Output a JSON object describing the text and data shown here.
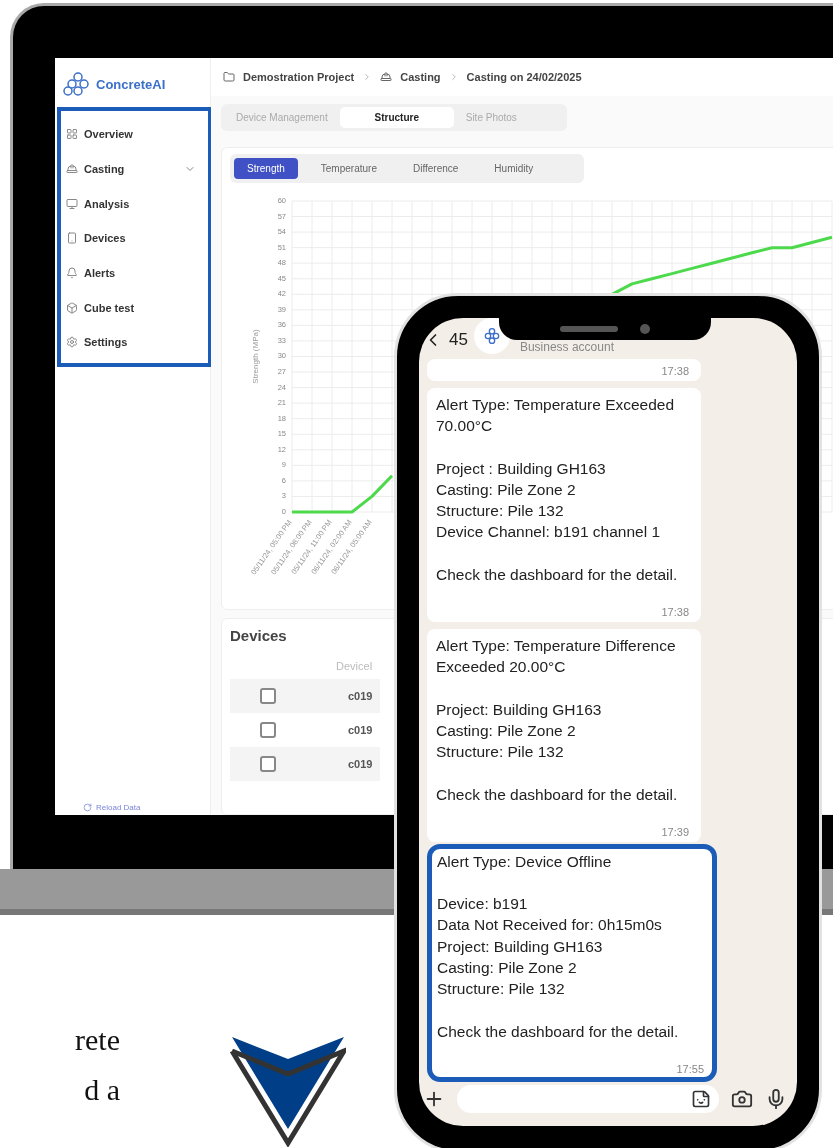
{
  "sidebar": {
    "logo": "ConcreteAI",
    "items": [
      {
        "label": "Overview",
        "expandable": false
      },
      {
        "label": "Casting",
        "expandable": true
      },
      {
        "label": "Analysis",
        "expandable": false
      },
      {
        "label": "Devices",
        "expandable": false
      },
      {
        "label": "Alerts",
        "expandable": false
      },
      {
        "label": "Cube test",
        "expandable": false
      },
      {
        "label": "Settings",
        "expandable": false
      }
    ],
    "reload": "Reload Data"
  },
  "breadcrumb": [
    "Demostration Project",
    "Casting",
    "Casting on 24/02/2025"
  ],
  "tabs": [
    {
      "label": "Device Management",
      "selected": false
    },
    {
      "label": "Structure",
      "selected": true
    },
    {
      "label": "Site Photos",
      "selected": false
    }
  ],
  "chart_tabs": [
    {
      "label": "Strength",
      "selected": true
    },
    {
      "label": "Temperature",
      "selected": false
    },
    {
      "label": "Difference",
      "selected": false
    },
    {
      "label": "Humidity",
      "selected": false
    }
  ],
  "chart_data": {
    "type": "line",
    "grid": true,
    "ylabel": "Strength (MPa)",
    "ylim": [
      0,
      60
    ],
    "yticks": [
      0,
      3,
      6,
      9,
      12,
      15,
      18,
      21,
      24,
      27,
      30,
      33,
      36,
      39,
      42,
      45,
      48,
      51,
      54,
      57,
      60
    ],
    "categories": [
      "05/11/24, 05:00 PM",
      "05/11/24, 08:00 PM",
      "05/11/24, 11:00 PM",
      "06/11/24, 02:00 AM",
      "06/11/24, 05:00 AM",
      null,
      null,
      null,
      null,
      null,
      null,
      null,
      null,
      null,
      null,
      null,
      null,
      null,
      null,
      null,
      null,
      null,
      null,
      null,
      null,
      null,
      null,
      null
    ],
    "series": [
      {
        "color": "#4cd94c",
        "values": [
          0,
          0,
          0,
          0,
          3,
          7,
          null,
          null,
          null,
          null,
          null,
          null,
          null,
          null,
          null,
          null,
          42,
          44,
          45,
          46,
          47,
          48,
          49,
          50,
          51,
          51,
          52,
          53
        ]
      }
    ]
  },
  "devices": {
    "title": "Devices",
    "column": "DeviceI",
    "rows": [
      {
        "id": "c019",
        "checked": false
      },
      {
        "id": "c019",
        "checked": false
      },
      {
        "id": "c019",
        "checked": false
      }
    ]
  },
  "phone": {
    "unread": "45",
    "subtitle": "Business account",
    "messages": [
      {
        "time": "17:38",
        "highlighted": false
      },
      {
        "paragraphs": [
          [
            "Alert Type: Temperature Exceeded 70.00°C"
          ],
          [
            "Project : Building GH163",
            "Casting: Pile Zone 2",
            "Structure: Pile 132",
            "Device Channel: b191 channel 1"
          ],
          [
            "Check the dashboard for the detail."
          ]
        ],
        "time": "17:38",
        "highlighted": false
      },
      {
        "paragraphs": [
          [
            "Alert Type: Temperature Difference Exceeded 20.00°C"
          ],
          [
            "Project: Building GH163",
            "Casting: Pile Zone 2",
            "Structure: Pile 132"
          ],
          [
            "Check the dashboard for the detail."
          ]
        ],
        "time": "17:39",
        "highlighted": false
      },
      {
        "paragraphs": [
          [
            "Alert Type: Device Offline"
          ],
          [
            "Device: b191",
            "Data Not Received for: 0h15m0s",
            "Project: Building GH163",
            "Casting: Pile Zone 2",
            "Structure: Pile 132"
          ],
          [
            "Check the dashboard for the detail."
          ]
        ],
        "time": "17:55",
        "highlighted": true
      }
    ]
  },
  "caption": [
    "rete",
    "d a"
  ]
}
